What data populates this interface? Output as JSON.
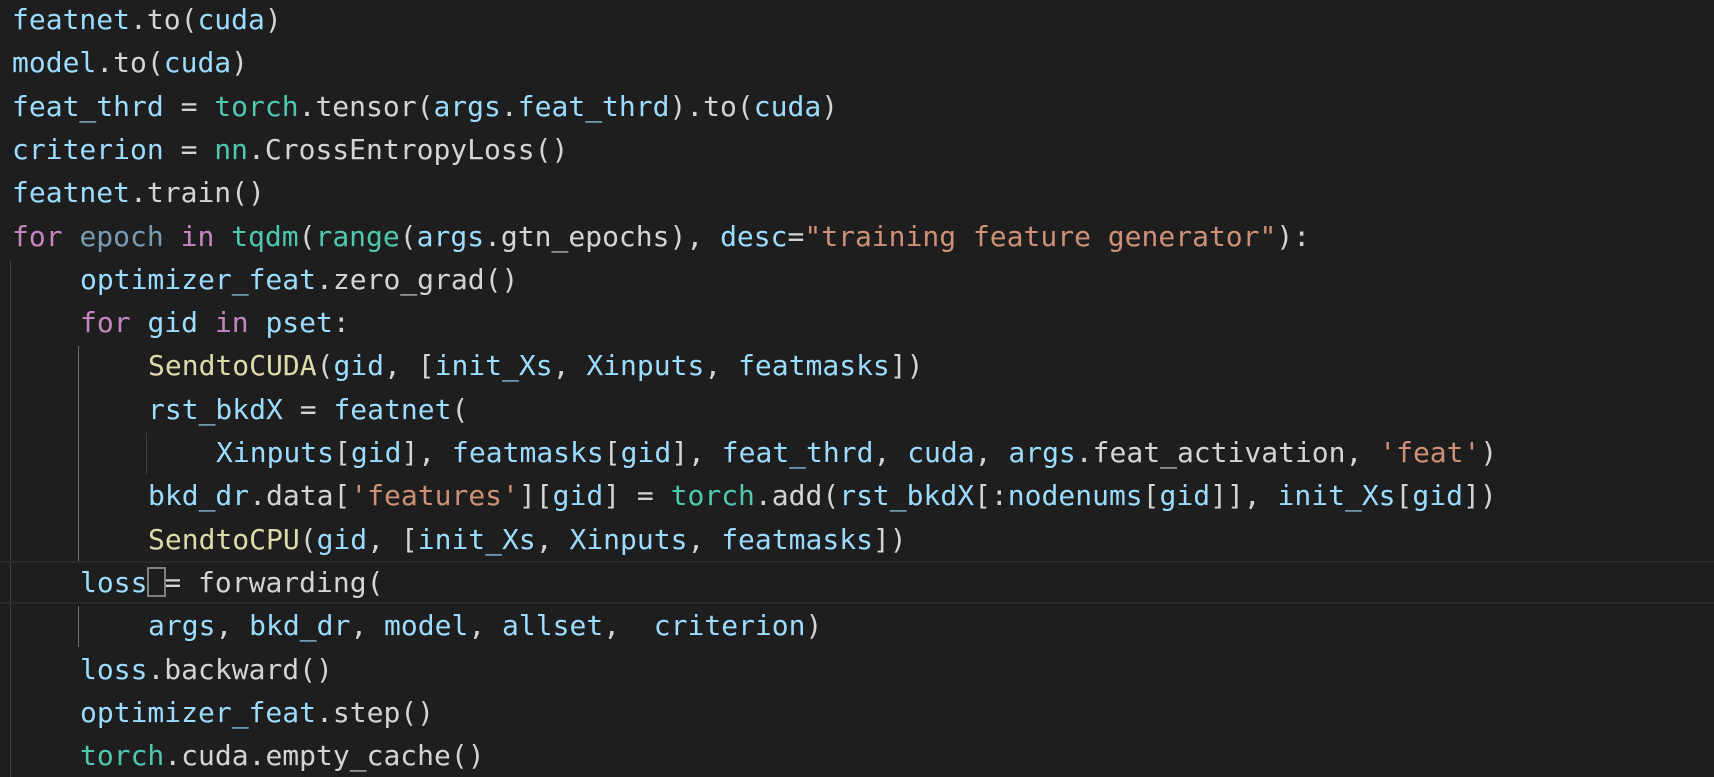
{
  "editor": {
    "language": "python",
    "theme": "dark",
    "colors": {
      "background": "#1e1e1e",
      "variable": "#9cdcfe",
      "function": "#dcdcaa",
      "module": "#4ec9b0",
      "keyword": "#c586c0",
      "string": "#ce9178",
      "punctuation": "#d4d4d4"
    },
    "cursor_line": 13,
    "lines": [
      {
        "indent": 0,
        "tokens": [
          {
            "t": "featnet",
            "c": "var"
          },
          {
            "t": ".",
            "c": "txt"
          },
          {
            "t": "to",
            "c": "txt"
          },
          {
            "t": "(",
            "c": "txt"
          },
          {
            "t": "cuda",
            "c": "var"
          },
          {
            "t": ")",
            "c": "txt"
          }
        ]
      },
      {
        "indent": 0,
        "tokens": [
          {
            "t": "model",
            "c": "var"
          },
          {
            "t": ".",
            "c": "txt"
          },
          {
            "t": "to",
            "c": "txt"
          },
          {
            "t": "(",
            "c": "txt"
          },
          {
            "t": "cuda",
            "c": "var"
          },
          {
            "t": ")",
            "c": "txt"
          }
        ]
      },
      {
        "indent": 0,
        "tokens": [
          {
            "t": "feat_thrd",
            "c": "var"
          },
          {
            "t": " = ",
            "c": "txt"
          },
          {
            "t": "torch",
            "c": "mod"
          },
          {
            "t": ".tensor(",
            "c": "txt"
          },
          {
            "t": "args",
            "c": "var"
          },
          {
            "t": ".",
            "c": "txt"
          },
          {
            "t": "feat_thrd",
            "c": "var"
          },
          {
            "t": ").to(",
            "c": "txt"
          },
          {
            "t": "cuda",
            "c": "var"
          },
          {
            "t": ")",
            "c": "txt"
          }
        ]
      },
      {
        "indent": 0,
        "tokens": [
          {
            "t": "criterion",
            "c": "var"
          },
          {
            "t": " = ",
            "c": "txt"
          },
          {
            "t": "nn",
            "c": "mod"
          },
          {
            "t": ".CrossEntropyLoss()",
            "c": "txt"
          }
        ]
      },
      {
        "indent": 0,
        "tokens": [
          {
            "t": "featnet",
            "c": "var"
          },
          {
            "t": ".train()",
            "c": "txt"
          }
        ]
      },
      {
        "indent": 0,
        "tokens": [
          {
            "t": "for",
            "c": "kw"
          },
          {
            "t": " ",
            "c": "txt"
          },
          {
            "t": "epoch",
            "c": "dim"
          },
          {
            "t": " ",
            "c": "txt"
          },
          {
            "t": "in",
            "c": "kw"
          },
          {
            "t": " ",
            "c": "txt"
          },
          {
            "t": "tqdm",
            "c": "mod"
          },
          {
            "t": "(",
            "c": "txt"
          },
          {
            "t": "range",
            "c": "mod"
          },
          {
            "t": "(",
            "c": "txt"
          },
          {
            "t": "args",
            "c": "var"
          },
          {
            "t": ".gtn_epochs), ",
            "c": "txt"
          },
          {
            "t": "desc",
            "c": "var"
          },
          {
            "t": "=",
            "c": "txt"
          },
          {
            "t": "\"training feature generator\"",
            "c": "str"
          },
          {
            "t": "):",
            "c": "txt"
          }
        ]
      },
      {
        "indent": 1,
        "tokens": [
          {
            "t": "optimizer_feat",
            "c": "var"
          },
          {
            "t": ".zero_grad()",
            "c": "txt"
          }
        ]
      },
      {
        "indent": 1,
        "tokens": [
          {
            "t": "for",
            "c": "kw"
          },
          {
            "t": " ",
            "c": "txt"
          },
          {
            "t": "gid",
            "c": "var"
          },
          {
            "t": " ",
            "c": "txt"
          },
          {
            "t": "in",
            "c": "kw"
          },
          {
            "t": " ",
            "c": "txt"
          },
          {
            "t": "pset",
            "c": "var"
          },
          {
            "t": ":",
            "c": "txt"
          }
        ]
      },
      {
        "indent": 2,
        "tokens": [
          {
            "t": "SendtoCUDA",
            "c": "fn"
          },
          {
            "t": "(",
            "c": "txt"
          },
          {
            "t": "gid",
            "c": "var"
          },
          {
            "t": ", [",
            "c": "txt"
          },
          {
            "t": "init_Xs",
            "c": "var"
          },
          {
            "t": ", ",
            "c": "txt"
          },
          {
            "t": "Xinputs",
            "c": "var"
          },
          {
            "t": ", ",
            "c": "txt"
          },
          {
            "t": "featmasks",
            "c": "var"
          },
          {
            "t": "])",
            "c": "txt"
          }
        ]
      },
      {
        "indent": 2,
        "tokens": [
          {
            "t": "rst_bkdX",
            "c": "var"
          },
          {
            "t": " = ",
            "c": "txt"
          },
          {
            "t": "featnet",
            "c": "var"
          },
          {
            "t": "(",
            "c": "txt"
          }
        ]
      },
      {
        "indent": 3,
        "tokens": [
          {
            "t": "Xinputs",
            "c": "var"
          },
          {
            "t": "[",
            "c": "txt"
          },
          {
            "t": "gid",
            "c": "var"
          },
          {
            "t": "], ",
            "c": "txt"
          },
          {
            "t": "featmasks",
            "c": "var"
          },
          {
            "t": "[",
            "c": "txt"
          },
          {
            "t": "gid",
            "c": "var"
          },
          {
            "t": "], ",
            "c": "txt"
          },
          {
            "t": "feat_thrd",
            "c": "var"
          },
          {
            "t": ", ",
            "c": "txt"
          },
          {
            "t": "cuda",
            "c": "var"
          },
          {
            "t": ", ",
            "c": "txt"
          },
          {
            "t": "args",
            "c": "var"
          },
          {
            "t": ".feat_activation, ",
            "c": "txt"
          },
          {
            "t": "'feat'",
            "c": "str"
          },
          {
            "t": ")",
            "c": "txt"
          }
        ]
      },
      {
        "indent": 2,
        "tokens": [
          {
            "t": "bkd_dr",
            "c": "var"
          },
          {
            "t": ".data[",
            "c": "txt"
          },
          {
            "t": "'features'",
            "c": "str"
          },
          {
            "t": "][",
            "c": "txt"
          },
          {
            "t": "gid",
            "c": "var"
          },
          {
            "t": "] = ",
            "c": "txt"
          },
          {
            "t": "torch",
            "c": "mod"
          },
          {
            "t": ".add(",
            "c": "txt"
          },
          {
            "t": "rst_bkdX",
            "c": "var"
          },
          {
            "t": "[:",
            "c": "txt"
          },
          {
            "t": "nodenums",
            "c": "var"
          },
          {
            "t": "[",
            "c": "txt"
          },
          {
            "t": "gid",
            "c": "var"
          },
          {
            "t": "]], ",
            "c": "txt"
          },
          {
            "t": "init_Xs",
            "c": "var"
          },
          {
            "t": "[",
            "c": "txt"
          },
          {
            "t": "gid",
            "c": "var"
          },
          {
            "t": "])",
            "c": "txt"
          }
        ]
      },
      {
        "indent": 2,
        "tokens": [
          {
            "t": "SendtoCPU",
            "c": "fn"
          },
          {
            "t": "(",
            "c": "txt"
          },
          {
            "t": "gid",
            "c": "var"
          },
          {
            "t": ", [",
            "c": "txt"
          },
          {
            "t": "init_Xs",
            "c": "var"
          },
          {
            "t": ", ",
            "c": "txt"
          },
          {
            "t": "Xinputs",
            "c": "var"
          },
          {
            "t": ", ",
            "c": "txt"
          },
          {
            "t": "featmasks",
            "c": "var"
          },
          {
            "t": "]",
            "c": "txt"
          },
          {
            "t": ")",
            "c": "txt"
          }
        ]
      },
      {
        "indent": 1,
        "tokens": [
          {
            "t": "loss",
            "c": "var"
          },
          {
            "t": " = forwarding(",
            "c": "txt"
          }
        ]
      },
      {
        "indent": 2,
        "tokens": [
          {
            "t": "args",
            "c": "var"
          },
          {
            "t": ", ",
            "c": "txt"
          },
          {
            "t": "bkd_dr",
            "c": "var"
          },
          {
            "t": ", ",
            "c": "txt"
          },
          {
            "t": "model",
            "c": "var"
          },
          {
            "t": ", ",
            "c": "txt"
          },
          {
            "t": "allset",
            "c": "var"
          },
          {
            "t": ",  ",
            "c": "txt"
          },
          {
            "t": "criterion",
            "c": "var"
          },
          {
            "t": ")",
            "c": "txt"
          }
        ]
      },
      {
        "indent": 1,
        "tokens": [
          {
            "t": "loss",
            "c": "var"
          },
          {
            "t": ".backward()",
            "c": "txt"
          }
        ]
      },
      {
        "indent": 1,
        "tokens": [
          {
            "t": "optimizer_feat",
            "c": "var"
          },
          {
            "t": ".step()",
            "c": "txt"
          }
        ]
      },
      {
        "indent": 1,
        "tokens": [
          {
            "t": "torch",
            "c": "mod"
          },
          {
            "t": ".cuda.empty_cache()",
            "c": "txt"
          }
        ]
      }
    ]
  }
}
